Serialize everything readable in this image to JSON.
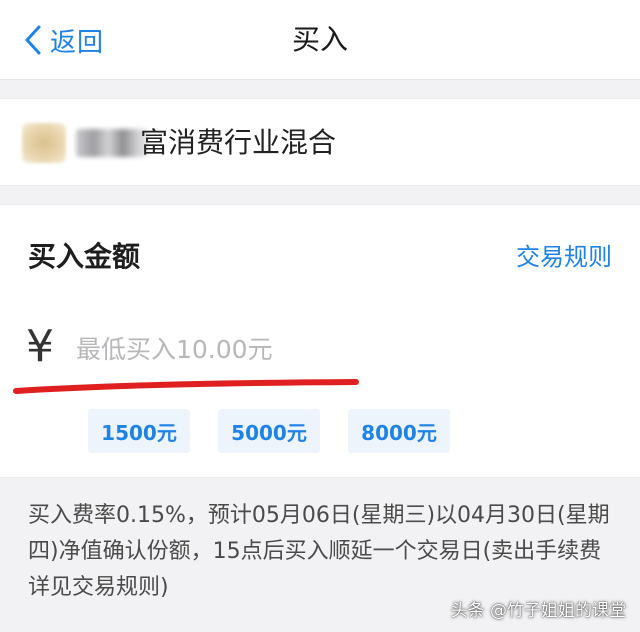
{
  "nav": {
    "back_label": "返回",
    "title": "买入"
  },
  "fund": {
    "name_visible": "富消费行业混合"
  },
  "amount": {
    "label": "买入金额",
    "rules_link": "交易规则",
    "currency_symbol": "¥",
    "input_value": "",
    "input_placeholder": "最低买入10.00元"
  },
  "quick_amounts": [
    "1500元",
    "5000元",
    "8000元"
  ],
  "note": "买入费率0.15%，预计05月06日(星期三)以04月30日(星期四)净值确认份额，15点后买入顺延一个交易日(卖出手续费详见交易规则)",
  "watermark": "头条 @竹子姐姐的课堂",
  "colors": {
    "accent_blue": "#1e82e6",
    "quick_button_bg": "#eef4fb",
    "annotation_red": "#e02020",
    "page_bg": "#f2f2f4"
  },
  "icons": {
    "back": "chevron-left-icon"
  }
}
